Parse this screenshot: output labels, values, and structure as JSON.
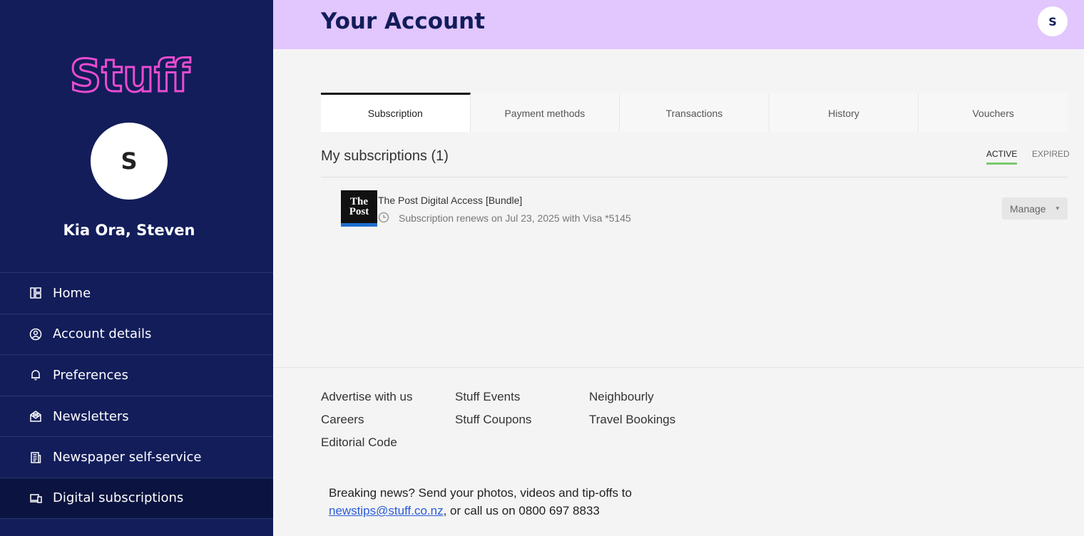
{
  "sidebar": {
    "logo_text": "Stuff",
    "avatar_initial": "S",
    "greeting": "Kia Ora, Steven",
    "items": [
      {
        "label": "Home",
        "icon": "home-icon"
      },
      {
        "label": "Account details",
        "icon": "user-circle-icon"
      },
      {
        "label": "Preferences",
        "icon": "bell-icon"
      },
      {
        "label": "Newsletters",
        "icon": "envelope-open-icon"
      },
      {
        "label": "Newspaper self-service",
        "icon": "newspaper-icon"
      },
      {
        "label": "Digital subscriptions",
        "icon": "devices-icon",
        "active": true
      }
    ]
  },
  "header": {
    "title": "Your Account",
    "avatar_initial": "S"
  },
  "tabs": [
    "Subscription",
    "Payment methods",
    "Transactions",
    "History",
    "Vouchers"
  ],
  "active_tab": "Subscription",
  "subscriptions": {
    "heading": "My subscriptions (1)",
    "filters": {
      "active": "ACTIVE",
      "expired": "EXPIRED"
    },
    "items": [
      {
        "logo_line1": "The",
        "logo_line2": "Post",
        "name": "The Post Digital Access [Bundle]",
        "renewal": "Subscription renews on Jul 23, 2025 with Visa *5145",
        "manage_label": "Manage",
        "caret": "▾"
      }
    ]
  },
  "footer": {
    "links": [
      {
        "label": "Advertise with us"
      },
      {
        "label": "Careers"
      },
      {
        "label": "Editorial Code"
      },
      {
        "label": "Stuff Events"
      },
      {
        "label": "Stuff Coupons"
      },
      {
        "label": "Neighbourly"
      },
      {
        "label": "Travel Bookings"
      }
    ],
    "breaking_text": "Breaking news? Send your photos, videos and tip-offs to",
    "email": "newstips@stuff.co.nz",
    "call_text": ", or call us on 0800 697 8833"
  },
  "colors": {
    "sidebar_bg": "#121d5a",
    "header_bg": "#e2c6fe",
    "logo_pink": "#e94ccf",
    "active_filter": "#7ac86f",
    "link_blue": "#2a5bd7"
  }
}
